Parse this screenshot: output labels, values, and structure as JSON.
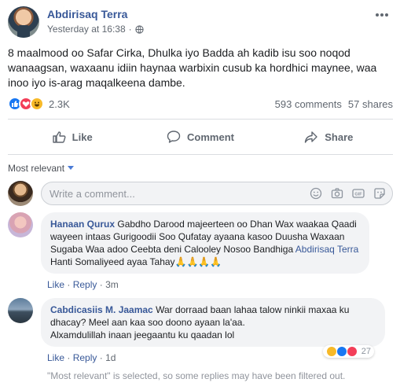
{
  "post": {
    "author": "Abdirisaq Terra",
    "timestamp": "Yesterday at 16:38",
    "separator": "·",
    "text": "8 maalmood oo Safar Cirka, Dhulka iyo Badda ah kadib isu soo noqod wanaagsan, waxaanu idiin haynaa warbixin cusub ka hordhici maynee, waa inoo iyo is-arag maqalkeena dambe.",
    "reaction_count": "2.3K",
    "comments_count": "593 comments",
    "shares_count": "57 shares"
  },
  "actions": {
    "like": "Like",
    "comment": "Comment",
    "share": "Share"
  },
  "sort": {
    "label": "Most relevant"
  },
  "composer": {
    "placeholder": "Write a comment..."
  },
  "comments": [
    {
      "name": "Hanaan Qurux",
      "text": "Gabdho Darood majeerteen oo Dhan Wax waakaa Qaadi wayeen intaas Gurigoodii Soo Qufatay ayaana kasoo Duusha Waxaan Sugaba Waa adoo Ceebta deni Calooley Nosoo Bandhiga",
      "mention": "Abdirisaq Terra",
      "text_after_mention": " Hanti Somaliyeed ayaa Tahay",
      "emoji": "🙏🙏🙏🙏",
      "like": "Like",
      "reply": "Reply",
      "time": "3m"
    },
    {
      "name": "Cabdicasiis M. Jaamac",
      "text": "War dorraad baan lahaa talow ninkii maxaa ku dhacay? Meel aan kaa soo doono ayaan la'aa.",
      "text2": "Alxamdulillah inaan jeegaantu ku qaadan lol",
      "like": "Like",
      "reply": "Reply",
      "time": "1d",
      "reaction_count": "27"
    }
  ],
  "dot": "·",
  "filtered_note": "\"Most relevant\" is selected, so some replies may have been filtered out.",
  "colors": {
    "link": "#385898",
    "like_blue": "#1877f2",
    "love_red": "#f33e58",
    "haha_yellow": "#f7b928",
    "muted": "#606770"
  }
}
